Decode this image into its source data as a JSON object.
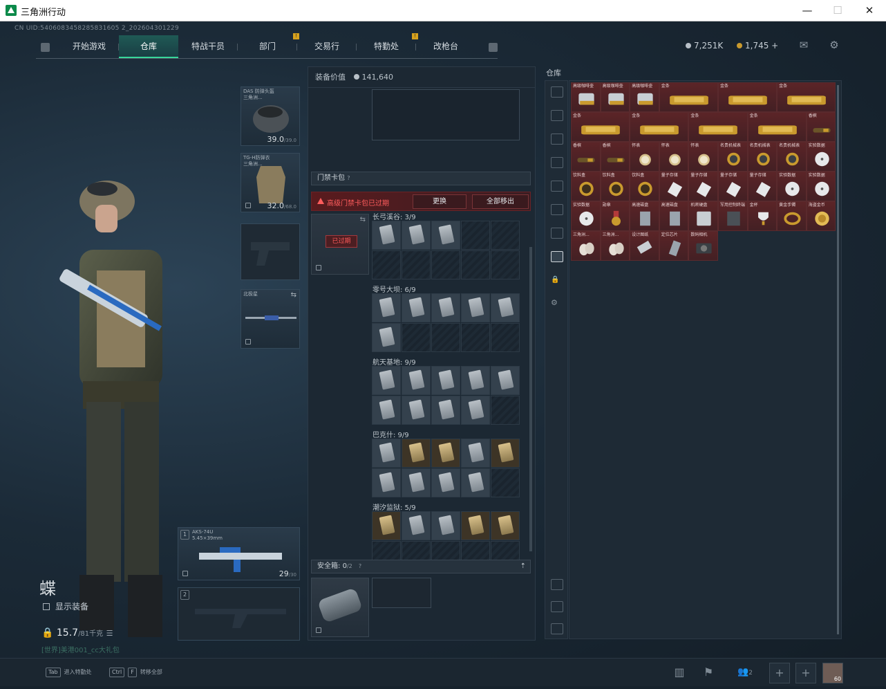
{
  "window": {
    "title": "三角洲行动",
    "min": "—",
    "max": "☐",
    "close": "✕"
  },
  "uid": "CN UID:5406083458285831605 2_202604301229",
  "nav": {
    "tabs": [
      "开始游戏",
      "仓库",
      "特战干员",
      "部门",
      "交易行",
      "特勤处",
      "改枪台"
    ],
    "active": "仓库",
    "badge": "!"
  },
  "currency": {
    "silver": "7,251K",
    "gold": "1,745 +"
  },
  "character": {
    "name": "蝶",
    "show_equipment": "显示装备",
    "weight": "15.7",
    "weight_max": "/81千克",
    "promo": "[世界]美港001_cc大礼包"
  },
  "equipment": {
    "helmet": {
      "name": "DAS 防弹头盔\n三角洲...",
      "durability": "39.0",
      "max": "/39.0"
    },
    "armor": {
      "name": "TG-H防弹衣\n三角洲...",
      "durability": "32.0",
      "max": "/68.0"
    },
    "melee": {
      "name": "北极星"
    },
    "primary": {
      "slot": "1",
      "name": "AKS-74U",
      "sub": "5.45×39mm",
      "ammo": "29",
      "ammo_max": "/30"
    },
    "secondary": {
      "slot": "2"
    }
  },
  "loadout": {
    "value_label": "装备价值",
    "value": "141,640",
    "keycard_header": "门禁卡包",
    "help": "?",
    "expired_text": "高级门禁卡包已过期",
    "replace_btn": "更换",
    "remove_all_btn": "全部移出",
    "expired_stamp": "已过期",
    "maps": [
      {
        "label": "长弓溪谷: 3/9",
        "filled": 3,
        "gold": []
      },
      {
        "label": "零号大坝: 6/9",
        "filled": 6,
        "gold": []
      },
      {
        "label": "航天基地: 9/9",
        "filled": 9,
        "gold": []
      },
      {
        "label": "巴克什: 9/9",
        "filled": 9,
        "gold": [
          1,
          2,
          4
        ]
      },
      {
        "label": "潮汐监狱: 5/9",
        "filled": 5,
        "gold": [
          0,
          3,
          4
        ]
      }
    ],
    "safebox_label": "安全箱:",
    "safebox_count": "0",
    "safebox_max": "/2"
  },
  "stash": {
    "title": "仓库",
    "items": [
      "高级咖啡壶",
      "高级咖啡壶",
      "高级咖啡壶",
      "金条",
      "金条",
      "金条",
      "金条",
      "金条",
      "金条",
      "金条",
      "香槟",
      "香槟",
      "香槟",
      "怀表",
      "怀表",
      "怀表",
      "名贵机械表",
      "名贵机械表",
      "名贵机械表",
      "实验数据",
      "饮料盒",
      "饮料盒",
      "饮料盒",
      "量子存储",
      "量子存储",
      "量子存储",
      "量子存储",
      "实验数据",
      "实验数据",
      "实验数据",
      "勋章",
      "高速磁盘",
      "高速磁盘",
      "机密硬盘",
      "军用控制终端",
      "金杯",
      "黄金手镯",
      "海盗金币",
      "三角洲...",
      "三角洲...",
      "设计图纸",
      "定位芯片",
      "数码相机"
    ],
    "colors": {
      "item_bg": "#5b2427",
      "gold": "#c99a2e",
      "silver": "#c8ced3"
    }
  },
  "bottom": {
    "hint1_key": "Tab",
    "hint1": "进入特勤处",
    "hint2_key": "Ctrl",
    "hint2_key2": "F",
    "hint2": "转移全部",
    "squad": "2",
    "level": "60",
    "plus": "+"
  }
}
